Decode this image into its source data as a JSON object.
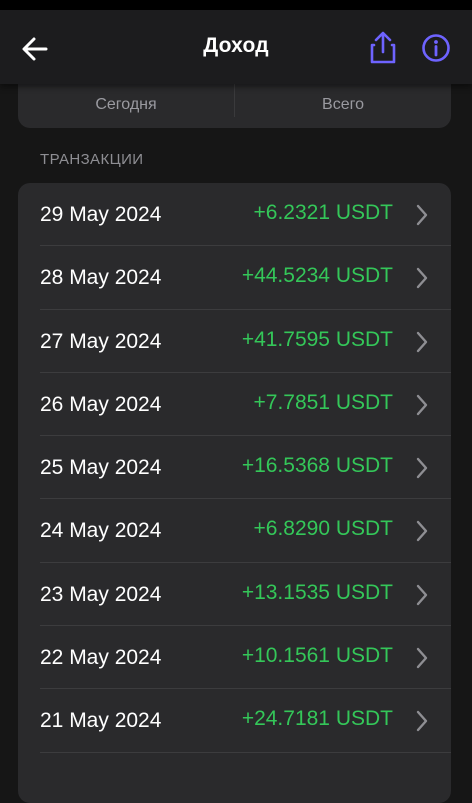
{
  "header": {
    "title": "Доход"
  },
  "summary": {
    "today_label": "Сегодня",
    "total_label": "Всего"
  },
  "transactions": {
    "section_title": "ТРАНЗАКЦИИ",
    "rows": [
      {
        "date": "29 May 2024",
        "amount": "+6.2321 USDT"
      },
      {
        "date": "28 May 2024",
        "amount": "+44.5234 USDT"
      },
      {
        "date": "27 May 2024",
        "amount": "+41.7595 USDT"
      },
      {
        "date": "26 May 2024",
        "amount": "+7.7851 USDT"
      },
      {
        "date": "25 May 2024",
        "amount": "+16.5368 USDT"
      },
      {
        "date": "24 May 2024",
        "amount": "+6.8290 USDT"
      },
      {
        "date": "23 May 2024",
        "amount": "+13.1535 USDT"
      },
      {
        "date": "22 May 2024",
        "amount": "+10.1561 USDT"
      },
      {
        "date": "21 May 2024",
        "amount": "+24.7181 USDT"
      }
    ]
  },
  "colors": {
    "accent": "#6e63ff",
    "positive": "#34c759",
    "background": "#161616",
    "card": "#2a2a2c"
  },
  "icons": {
    "back": "arrow-left-icon",
    "share": "share-icon",
    "info": "info-icon",
    "row_chevron": "chevron-right-icon"
  }
}
